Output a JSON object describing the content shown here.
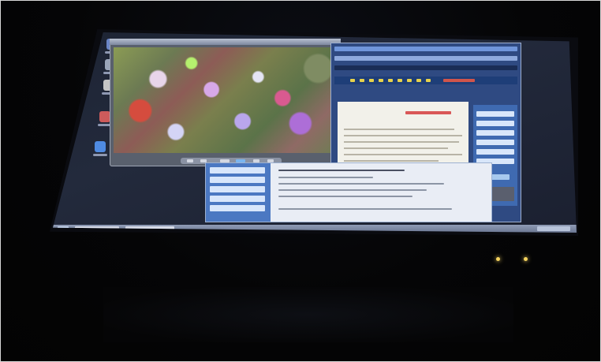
{
  "scene": {
    "kind": "photo-of-laptop-screen"
  },
  "desktop": {
    "icons": [
      {
        "name": "computer-icon",
        "color": "#6b86c7"
      },
      {
        "name": "documents-icon",
        "color": "#9aa5b9"
      },
      {
        "name": "recycle-bin-icon",
        "color": "#c5c5c5"
      },
      {
        "name": "folder-icon",
        "color": "#cd5b5b"
      },
      {
        "name": "browser-icon",
        "color": "#4f8be2"
      }
    ]
  },
  "windows": {
    "photo_viewer": {
      "icon": "image-icon"
    },
    "browser": {
      "accent": "#2f4a82",
      "sidebar_color": "#3f6ab1",
      "title_color": "#d95757"
    },
    "lower_content": {
      "panel_color": "#4b78c2"
    }
  },
  "taskbar": {
    "color": "#7b88a5"
  }
}
